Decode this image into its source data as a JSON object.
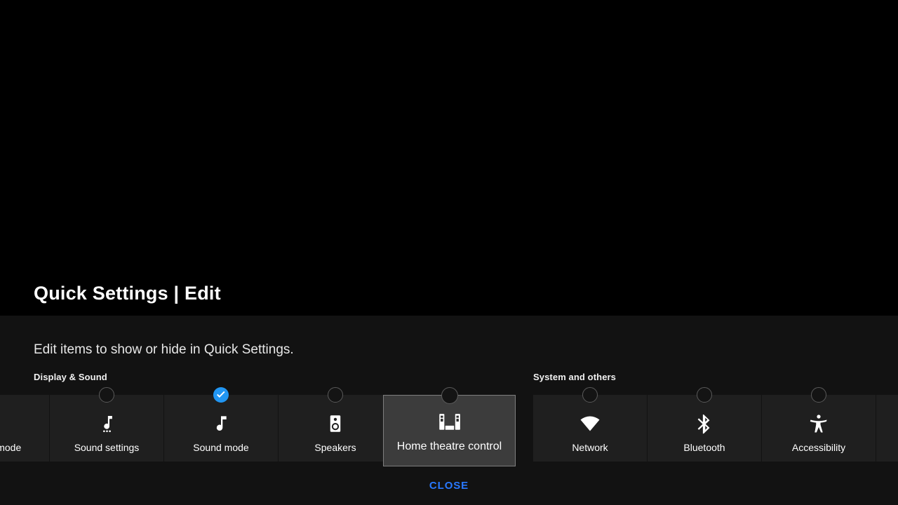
{
  "dialog": {
    "title": "Quick Settings | Edit",
    "description": "Edit items to show or hide in Quick Settings.",
    "close_label": "CLOSE"
  },
  "colors": {
    "backdrop": "#000000",
    "sheet": "#121212",
    "tile": "#1f1f1f",
    "tile_focused": "#3c3c3c",
    "tile_focused_border": "#7e7e7e",
    "accent_checked": "#2196f3",
    "accent_link": "#2979ff",
    "marker_outline": "#5a5a5a",
    "text_primary": "#ffffff"
  },
  "sections": [
    {
      "name": "display-and-sound",
      "header": "Display & Sound",
      "tiles": [
        {
          "label": "Picture mode",
          "icon": "picture-mode-icon",
          "checked": false,
          "partial": true,
          "focused": false
        },
        {
          "label": "Sound settings",
          "icon": "sound-settings-icon",
          "checked": false,
          "partial": false,
          "focused": false
        },
        {
          "label": "Sound mode",
          "icon": "sound-mode-icon",
          "checked": true,
          "partial": false,
          "focused": false
        },
        {
          "label": "Speakers",
          "icon": "speakers-icon",
          "checked": false,
          "partial": false,
          "focused": false
        },
        {
          "label": "Home theatre control",
          "icon": "home-theatre-icon",
          "checked": false,
          "partial": false,
          "focused": true
        }
      ]
    },
    {
      "name": "system-and-others",
      "header": "System and others",
      "tiles": [
        {
          "label": "Network",
          "icon": "wifi-icon",
          "checked": false,
          "partial": false,
          "focused": false
        },
        {
          "label": "Bluetooth",
          "icon": "bluetooth-icon",
          "checked": false,
          "partial": false,
          "focused": false
        },
        {
          "label": "Accessibility",
          "icon": "accessibility-icon",
          "checked": false,
          "partial": false,
          "focused": false
        },
        {
          "label": "",
          "icon": "",
          "checked": false,
          "partial": true,
          "focused": false
        }
      ]
    }
  ]
}
